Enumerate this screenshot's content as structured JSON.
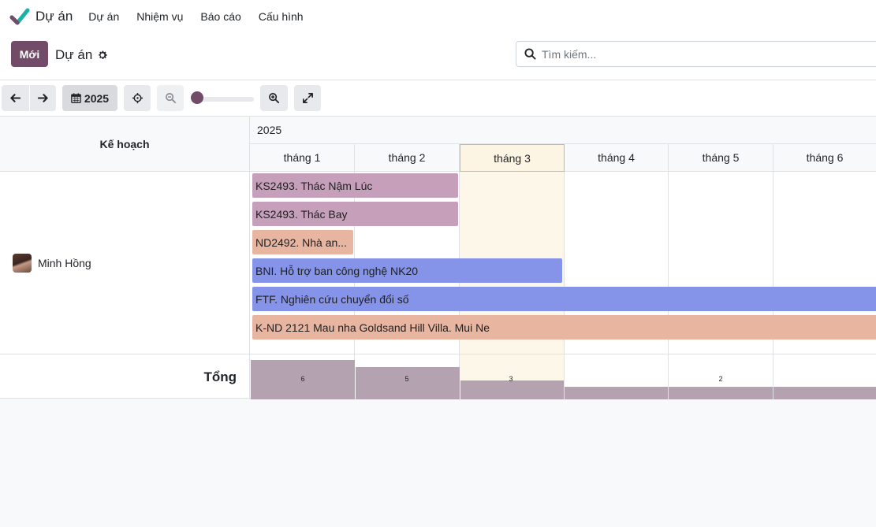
{
  "navbar": {
    "app_title": "Dự án",
    "menu": [
      "Dự án",
      "Nhiệm vụ",
      "Báo cáo",
      "Cấu hình"
    ]
  },
  "control_panel": {
    "new_button": "Mới",
    "breadcrumb": "Dự án",
    "search_placeholder": "Tìm kiếm..."
  },
  "toolbar": {
    "period_label": "2025"
  },
  "gantt": {
    "group_header": "Kế hoạch",
    "year": "2025",
    "months": [
      "tháng 1",
      "tháng 2",
      "tháng 3",
      "tháng 4",
      "tháng 5",
      "tháng 6"
    ],
    "today_month_index": 2,
    "rows": [
      {
        "name": "Minh Hồng",
        "tasks": [
          {
            "label": "KS2493. Thác Nậm Lúc",
            "color": "#c6a0bb"
          },
          {
            "label": "KS2493. Thác Bay",
            "color": "#c6a0bb"
          },
          {
            "label": "ND2492. Nhà an...",
            "color": "#e8b5a0"
          },
          {
            "label": "BNI. Hỗ trợ ban công nghệ NK20",
            "color": "#8593e8"
          },
          {
            "label": "FTF. Nghiên cứu chuyển đổi số",
            "color": "#8593e8"
          },
          {
            "label": "K-ND 2121 Mau nha Goldsand Hill Villa. Mui Ne",
            "color": "#e8b5a0"
          }
        ]
      }
    ],
    "totals_label": "Tổng",
    "totals": [
      "6",
      "5",
      "3",
      "",
      "2",
      ""
    ],
    "accent_color": "#714b67",
    "total_bar_color": "#b4a2b0"
  }
}
